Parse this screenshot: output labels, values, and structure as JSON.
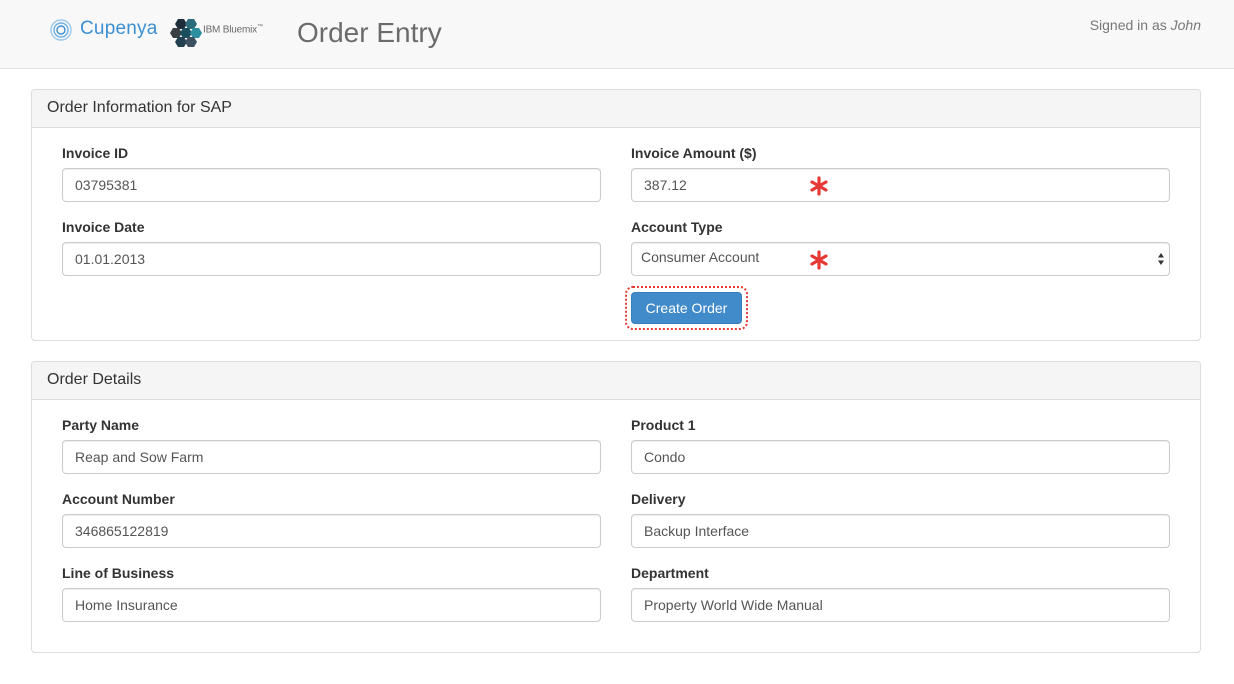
{
  "header": {
    "brand": "Cupenya",
    "partner_brand": "IBM Bluemix",
    "partner_tm": "™",
    "page_title": "Order Entry",
    "signed_in_prefix": "Signed in as",
    "user": "John"
  },
  "order_info": {
    "heading": "Order Information for SAP",
    "invoice_id": {
      "label": "Invoice ID",
      "value": "03795381"
    },
    "invoice_amount": {
      "label": "Invoice Amount ($)",
      "value": "387.12"
    },
    "invoice_date": {
      "label": "Invoice Date",
      "value": "01.01.2013"
    },
    "account_type": {
      "label": "Account Type",
      "value": "Consumer Account"
    },
    "create_button": "Create Order"
  },
  "order_details": {
    "heading": "Order Details",
    "party_name": {
      "label": "Party Name",
      "value": "Reap and Sow Farm"
    },
    "product": {
      "label": "Product 1",
      "value": "Condo"
    },
    "account_number": {
      "label": "Account Number",
      "value": "346865122819"
    },
    "delivery": {
      "label": "Delivery",
      "value": "Backup Interface"
    },
    "line_of_business": {
      "label": "Line of Business",
      "value": "Home Insurance"
    },
    "department": {
      "label": "Department",
      "value": "Property World Wide Manual"
    }
  },
  "icons": {
    "brand_logo": "cupenya-logo-icon",
    "partner_logo": "bluemix-hexagon-icon",
    "required": "required-asterisk-icon",
    "select": "select-updown-arrows-icon"
  },
  "colors": {
    "brand": "#3c8fd2",
    "primary_button": "#428bca",
    "required": "#e53935",
    "highlight": "#e53935"
  }
}
